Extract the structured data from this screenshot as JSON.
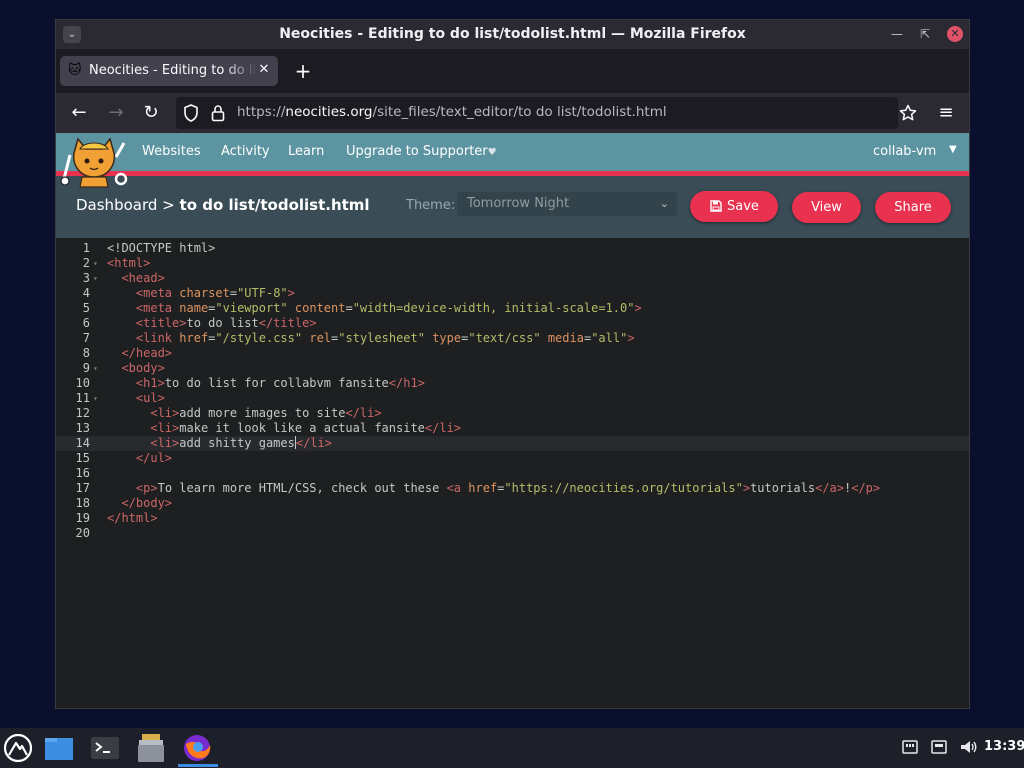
{
  "window": {
    "title": "Neocities - Editing to do list/todolist.html — Mozilla Firefox",
    "menu_icon": "chevron-down-icon",
    "controls": [
      "minimize-icon",
      "restore-icon",
      "close-icon"
    ]
  },
  "tabs": [
    {
      "label": "Neocities - Editing to do list/todolist.html",
      "icon": "neocities-cat-icon"
    }
  ],
  "toolbar": {
    "url_prefix": "https://",
    "url_domain": "neocities.org",
    "url_path": "/site_files/text_editor/to do list/todolist.html"
  },
  "neocities": {
    "nav": [
      "Websites",
      "Activity",
      "Learn",
      "Upgrade to Supporter"
    ],
    "user": "collab-vm",
    "breadcrumb_root": "Dashboard",
    "breadcrumb_sep": ">",
    "breadcrumb_file": "to do list/todolist.html",
    "theme_label": "Theme:",
    "theme_value": "Tomorrow Night",
    "save_label": "Save",
    "view_label": "View",
    "share_label": "Share",
    "colors": {
      "header": "#5c95a1",
      "accent": "#e93250",
      "bar": "#3a4d57"
    }
  },
  "editor": {
    "active_line": 14,
    "lines": [
      [
        [
          "x",
          "<!DOCTYPE html>"
        ]
      ],
      [
        [
          "t",
          "<html>"
        ]
      ],
      [
        [
          "x",
          "  "
        ],
        [
          "t",
          "<head>"
        ]
      ],
      [
        [
          "x",
          "    "
        ],
        [
          "t",
          "<meta "
        ],
        [
          "a",
          "charset"
        ],
        [
          "x",
          "="
        ],
        [
          "s",
          "\"UTF-8\""
        ],
        [
          "t",
          ">"
        ]
      ],
      [
        [
          "x",
          "    "
        ],
        [
          "t",
          "<meta "
        ],
        [
          "a",
          "name"
        ],
        [
          "x",
          "="
        ],
        [
          "s",
          "\"viewport\""
        ],
        [
          "x",
          " "
        ],
        [
          "a",
          "content"
        ],
        [
          "x",
          "="
        ],
        [
          "s",
          "\"width=device-width, initial-scale=1.0\""
        ],
        [
          "t",
          ">"
        ]
      ],
      [
        [
          "x",
          "    "
        ],
        [
          "t",
          "<title>"
        ],
        [
          "x",
          "to do list"
        ],
        [
          "t",
          "</title>"
        ]
      ],
      [
        [
          "x",
          "    "
        ],
        [
          "t",
          "<link "
        ],
        [
          "a",
          "href"
        ],
        [
          "x",
          "="
        ],
        [
          "s",
          "\"/style.css\""
        ],
        [
          "x",
          " "
        ],
        [
          "a",
          "rel"
        ],
        [
          "x",
          "="
        ],
        [
          "s",
          "\"stylesheet\""
        ],
        [
          "x",
          " "
        ],
        [
          "a",
          "type"
        ],
        [
          "x",
          "="
        ],
        [
          "s",
          "\"text/css\""
        ],
        [
          "x",
          " "
        ],
        [
          "a",
          "media"
        ],
        [
          "x",
          "="
        ],
        [
          "s",
          "\"all\""
        ],
        [
          "t",
          ">"
        ]
      ],
      [
        [
          "x",
          "  "
        ],
        [
          "t",
          "</head>"
        ]
      ],
      [
        [
          "x",
          "  "
        ],
        [
          "t",
          "<body>"
        ]
      ],
      [
        [
          "x",
          "    "
        ],
        [
          "t",
          "<h1>"
        ],
        [
          "x",
          "to do list for collabvm fansite"
        ],
        [
          "t",
          "</h1>"
        ]
      ],
      [
        [
          "x",
          "    "
        ],
        [
          "t",
          "<ul>"
        ]
      ],
      [
        [
          "x",
          "      "
        ],
        [
          "t",
          "<li>"
        ],
        [
          "x",
          "add more images to site"
        ],
        [
          "t",
          "</li>"
        ]
      ],
      [
        [
          "x",
          "      "
        ],
        [
          "t",
          "<li>"
        ],
        [
          "x",
          "make it look like a actual fansite"
        ],
        [
          "t",
          "</li>"
        ]
      ],
      [
        [
          "x",
          "      "
        ],
        [
          "t",
          "<li>"
        ],
        [
          "x",
          "add shitty games"
        ],
        [
          "c",
          ""
        ],
        [
          "t",
          "</li>"
        ]
      ],
      [
        [
          "x",
          "    "
        ],
        [
          "t",
          "</ul>"
        ]
      ],
      [],
      [
        [
          "x",
          "    "
        ],
        [
          "t",
          "<p>"
        ],
        [
          "x",
          "To learn more HTML/CSS, check out these "
        ],
        [
          "t",
          "<a "
        ],
        [
          "a",
          "href"
        ],
        [
          "x",
          "="
        ],
        [
          "s",
          "\"https://neocities.org/tutorials\""
        ],
        [
          "t",
          ">"
        ],
        [
          "x",
          "tutorials"
        ],
        [
          "t",
          "</a>"
        ],
        [
          "x",
          "!"
        ],
        [
          "t",
          "</p>"
        ]
      ],
      [
        [
          "x",
          "  "
        ],
        [
          "t",
          "</body>"
        ]
      ],
      [
        [
          "t",
          "</html>"
        ]
      ],
      []
    ],
    "fold_lines": [
      2,
      3,
      9,
      11
    ]
  },
  "taskbar": {
    "apps": [
      "launcher-icon",
      "file-manager-icon",
      "terminal-icon",
      "archive-manager-icon",
      "firefox-icon"
    ],
    "time": "13:39"
  }
}
